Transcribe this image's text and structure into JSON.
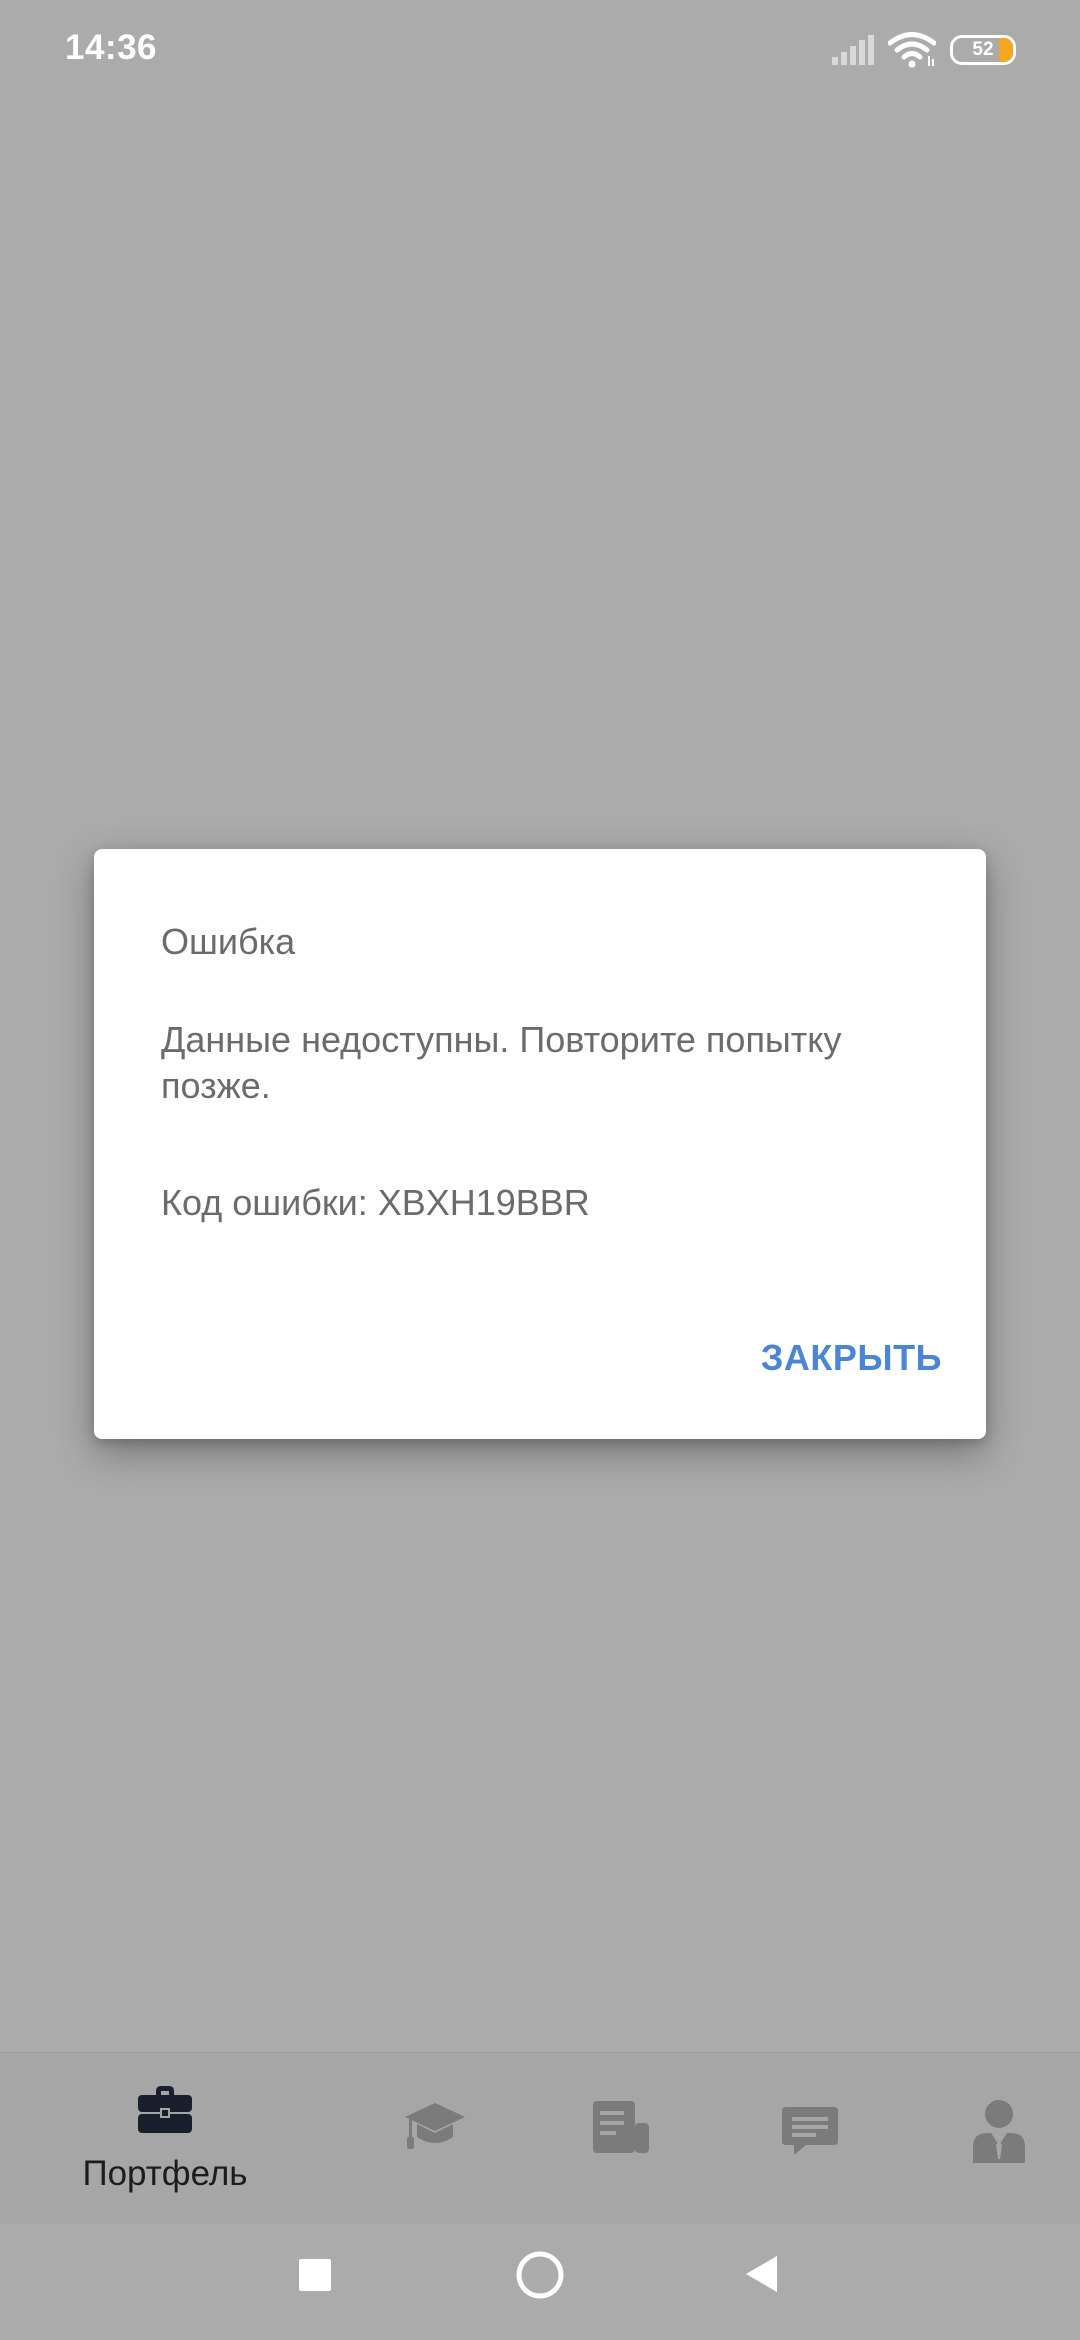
{
  "status_bar": {
    "time": "14:36",
    "battery_level": "52",
    "icons": [
      "signal-icon",
      "wifi-icon",
      "battery-icon"
    ],
    "battery_accent": "#f5a623"
  },
  "dialog": {
    "title": "Ошибка",
    "message": "Данные недоступны. Повторите попытку позже.",
    "error_code": "Код ошибки: XBXH19BBR",
    "close_label": "ЗАКРЫТЬ",
    "button_color": "#4a86d4"
  },
  "bottom_nav": {
    "items": [
      {
        "label": "Портфель",
        "icon": "briefcase-icon",
        "active": true
      },
      {
        "label": "",
        "icon": "graduation-cap-icon",
        "active": false
      },
      {
        "label": "",
        "icon": "news-icon",
        "active": false
      },
      {
        "label": "",
        "icon": "chat-icon",
        "active": false
      },
      {
        "label": "",
        "icon": "profile-icon",
        "active": false
      }
    ],
    "active_color": "#1a1f2e",
    "inactive_color": "#7b7b7b"
  },
  "system_nav": {
    "buttons": [
      "recents-square-icon",
      "home-circle-icon",
      "back-triangle-icon"
    ]
  },
  "overlay_color": "#ababab"
}
